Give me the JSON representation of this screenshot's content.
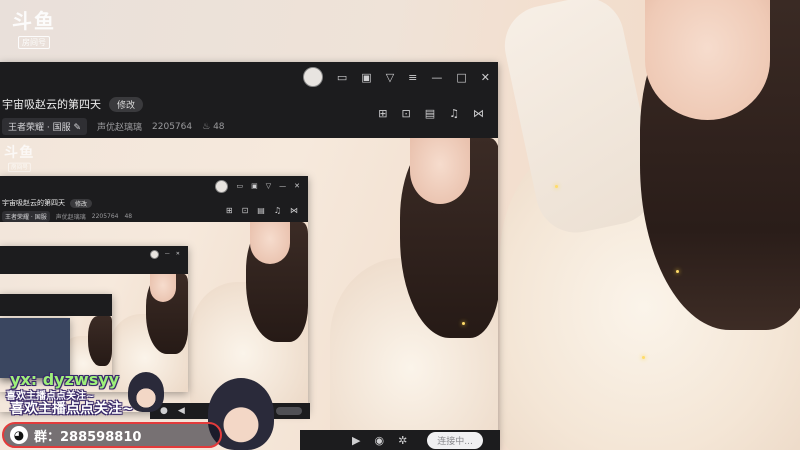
{
  "logo": {
    "mark": "斗鱼",
    "badge": "房间号"
  },
  "room": {
    "title": "宇宙吸赵云的第四天",
    "edit_label": "修改",
    "category": "王者荣耀 · 国服",
    "streamer_label": "声优赵璃璃",
    "room_number": "2205764",
    "heat_count": "48"
  },
  "window_icons": {
    "avatar": "avatar",
    "tv": "tv-icon",
    "screen": "screen-icon",
    "filter": "filter-icon",
    "menu": "menu-icon",
    "minimize": "minimize-icon",
    "maximize": "maximize-icon",
    "close": "close-icon"
  },
  "tools": [
    "gift-icon",
    "lock-icon",
    "calendar-icon",
    "bell-icon",
    "share-icon"
  ],
  "controls": {
    "send_placeholder": "连接中...",
    "icons": [
      "camera-icon",
      "eye-icon",
      "gear-icon"
    ]
  },
  "overlay": {
    "handle": "yx: dyzwsyy",
    "like_small": "喜欢主播点点关注~",
    "like_big": "喜欢主播点点关注~",
    "group": "群：288598810"
  },
  "colors": {
    "window_bg": "#1c1c1e",
    "accent_red": "#e33b3b",
    "handle_green": "#9ef07a"
  }
}
